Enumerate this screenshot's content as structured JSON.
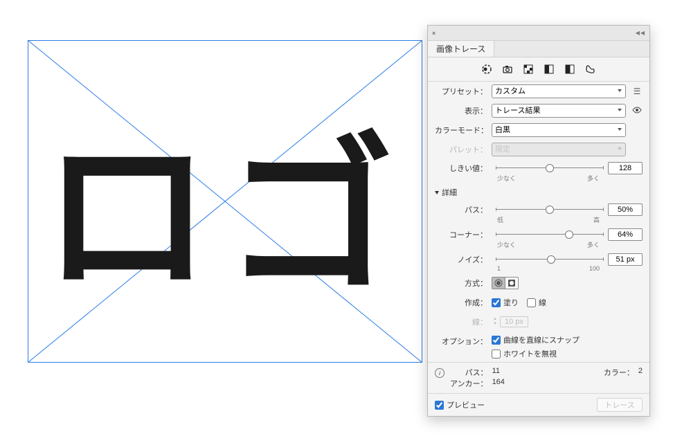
{
  "canvas": {
    "text": "ロゴ"
  },
  "panel": {
    "tab": "画像トレース",
    "preset_label": "プリセット：",
    "display_label": "表示：",
    "colormode_label": "カラーモード：",
    "palette_label": "パレット：",
    "threshold_label": "しきい値：",
    "detail_label": "詳細",
    "paths_label": "パス：",
    "corners_label": "コーナー：",
    "noise_label": "ノイズ：",
    "method_label": "方式：",
    "create_label": "作成：",
    "stroke_width_label": "線：",
    "options_label": "オプション：",
    "preset_value": "カスタム",
    "display_value": "トレース結果",
    "colormode_value": "白黒",
    "palette_value": "限定",
    "threshold": {
      "value": "128",
      "min": "少なく",
      "max": "多く",
      "pos": 50
    },
    "paths": {
      "value": "50%",
      "min": "低",
      "max": "高",
      "pos": 50
    },
    "corners": {
      "value": "64%",
      "min": "少なく",
      "max": "多く",
      "pos": 68
    },
    "noise": {
      "value": "51 px",
      "min": "1",
      "max": "100",
      "pos": 51
    },
    "create_fill": "塗り",
    "create_stroke": "線",
    "stroke_width_value": "10 px",
    "option_snap": "曲線を直線にスナップ",
    "option_ignore_white": "ホワイトを無視",
    "stats_paths_l": "パス：",
    "stats_paths_v": "11",
    "stats_colors_l": "カラー：",
    "stats_colors_v": "2",
    "stats_anchors_l": "アンカー：",
    "stats_anchors_v": "164",
    "preview_label": "プレビュー",
    "trace_button": "トレース"
  }
}
